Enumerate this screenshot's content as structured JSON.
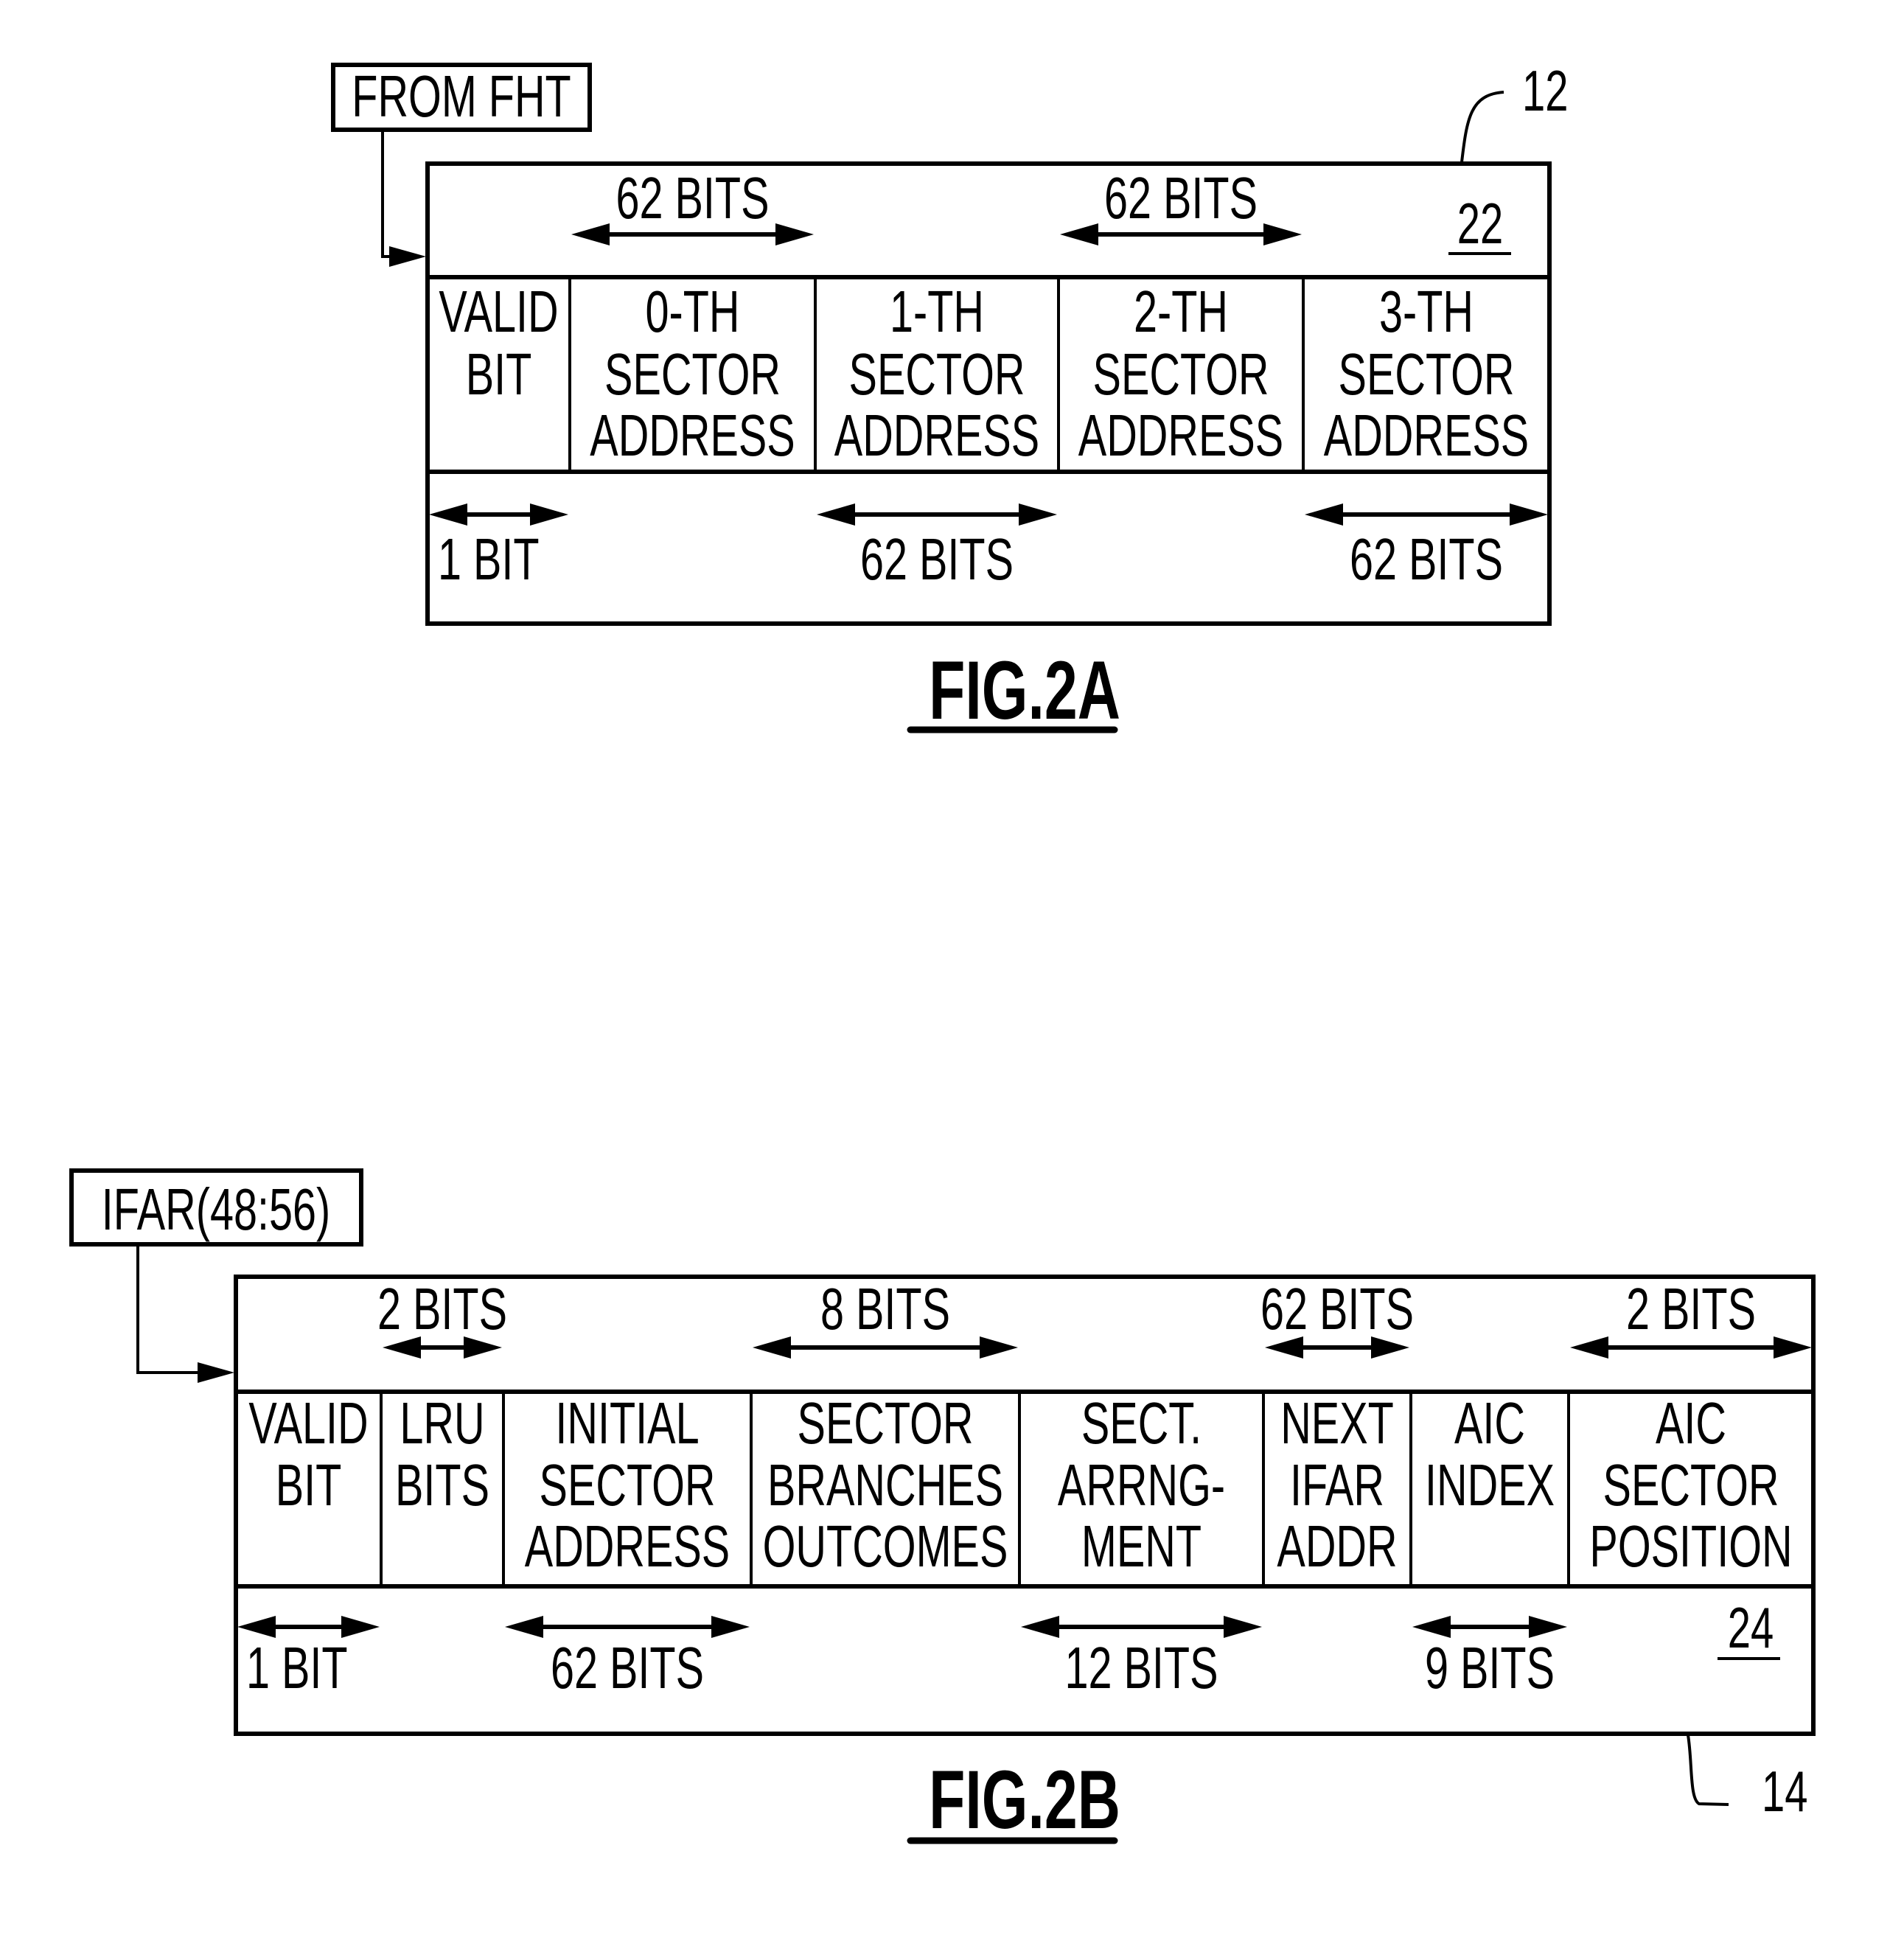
{
  "figures": [
    {
      "id": "fig2a",
      "caption": "FIG.2A",
      "source_label": "FROM FHT",
      "box_ref": "12",
      "row_ref": "22",
      "fields": [
        {
          "lines": [
            "VALID",
            "BIT"
          ],
          "width_bits": "1 BIT",
          "bits_row": "bottom"
        },
        {
          "lines": [
            "0-TH",
            "SECTOR",
            "ADDRESS"
          ],
          "width_bits": "62 BITS",
          "bits_row": "top"
        },
        {
          "lines": [
            "1-TH",
            "SECTOR",
            "ADDRESS"
          ],
          "width_bits": "62 BITS",
          "bits_row": "bottom"
        },
        {
          "lines": [
            "2-TH",
            "SECTOR",
            "ADDRESS"
          ],
          "width_bits": "62 BITS",
          "bits_row": "top"
        },
        {
          "lines": [
            "3-TH",
            "SECTOR",
            "ADDRESS"
          ],
          "width_bits": "62 BITS",
          "bits_row": "bottom"
        }
      ]
    },
    {
      "id": "fig2b",
      "caption": "FIG.2B",
      "source_label": "IFAR(48:56)",
      "box_ref": "14",
      "row_ref": "24",
      "fields": [
        {
          "lines": [
            "VALID",
            "BIT"
          ],
          "width_bits": "1 BIT",
          "bits_row": "bottom"
        },
        {
          "lines": [
            "LRU",
            "BITS"
          ],
          "width_bits": "2 BITS",
          "bits_row": "top"
        },
        {
          "lines": [
            "INITIAL",
            "SECTOR",
            "ADDRESS"
          ],
          "width_bits": "62 BITS",
          "bits_row": "bottom"
        },
        {
          "lines": [
            "SECTOR",
            "BRANCHES",
            "OUTCOMES"
          ],
          "width_bits": "8 BITS",
          "bits_row": "top"
        },
        {
          "lines": [
            "SECT.",
            "ARRNG-",
            "MENT"
          ],
          "width_bits": "12 BITS",
          "bits_row": "bottom"
        },
        {
          "lines": [
            "NEXT",
            "IFAR",
            "ADDR"
          ],
          "width_bits": "62 BITS",
          "bits_row": "top"
        },
        {
          "lines": [
            "AIC",
            "INDEX"
          ],
          "width_bits": "9 BITS",
          "bits_row": "bottom"
        },
        {
          "lines": [
            "AIC",
            "SECTOR",
            "POSITION"
          ],
          "width_bits": "2 BITS",
          "bits_row": "top"
        }
      ]
    }
  ]
}
